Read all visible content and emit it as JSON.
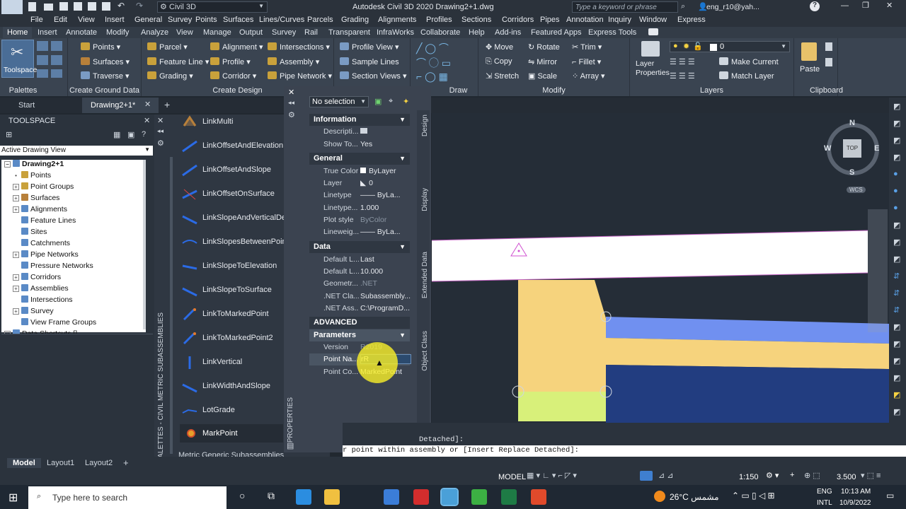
{
  "titlebar": {
    "app_badge": "C3D",
    "workspace": "Civil 3D",
    "title": "Autodesk Civil 3D 2020   Drawing2+1.dwg",
    "search_placeholder": "Type a keyword or phrase",
    "user": "eng_r10@yah..."
  },
  "menubar": [
    "File",
    "Edit",
    "View",
    "Insert",
    "General",
    "Survey",
    "Points",
    "Surfaces",
    "Lines/Curves",
    "Parcels",
    "Grading",
    "Alignments",
    "Profiles",
    "Sections",
    "Corridors",
    "Pipes",
    "Annotation",
    "Inquiry",
    "Window",
    "Express"
  ],
  "ribbon_tabs": [
    "Home",
    "Insert",
    "Annotate",
    "Modify",
    "Analyze",
    "View",
    "Manage",
    "Output",
    "Survey",
    "Rail",
    "Transparent",
    "InfraWorks",
    "Collaborate",
    "Help",
    "Add-ins",
    "Featured Apps",
    "Express Tools"
  ],
  "ribbon": {
    "palettes": {
      "big": "Toolspace",
      "label": "Palettes"
    },
    "ground": {
      "items": [
        "Points",
        "Surfaces",
        "Traverse"
      ],
      "label": "Create Ground Data"
    },
    "design": {
      "items": [
        "Parcel",
        "Feature Line",
        "Grading",
        "Alignment",
        "Profile",
        "Corridor",
        "Intersections",
        "Assembly",
        "Pipe Network"
      ],
      "label": "Create Design"
    },
    "profile": {
      "items": [
        "Profile View",
        "Sample Lines",
        "Section Views"
      ]
    },
    "draw": {
      "label": "Draw"
    },
    "modify": {
      "items": [
        "Move",
        "Copy",
        "Stretch",
        "Rotate",
        "Mirror",
        "Scale",
        "Trim",
        "Fillet",
        "Array"
      ],
      "label": "Modify"
    },
    "layers": {
      "big": "Layer Properties",
      "items": [
        "Make Current",
        "Match Layer"
      ],
      "layer_name": "0",
      "label": "Layers"
    },
    "clipboard": {
      "big": "Paste",
      "label": "Clipboard"
    }
  },
  "doctabs": {
    "start": "Start",
    "drawing": "Drawing2+1*"
  },
  "toolspace": {
    "title": "TOOLSPACE",
    "view": "Active Drawing View",
    "root": "Drawing2+1",
    "items": [
      "Points",
      "Point Groups",
      "Surfaces",
      "Alignments",
      "Feature Lines",
      "Sites",
      "Catchments",
      "Pipe Networks",
      "Pressure Networks",
      "Corridors",
      "Assemblies",
      "Intersections",
      "Survey",
      "View Frame Groups",
      "Data Shortcuts []"
    ]
  },
  "palette": {
    "items": [
      "LinkMulti",
      "LinkOffsetAndElevation",
      "LinkOffsetAndSlope",
      "LinkOffsetOnSurface",
      "LinkSlopeAndVerticalDefl",
      "LinkSlopesBetweenPoints",
      "LinkSlopeToElevation",
      "LinkSlopeToSurface",
      "LinkToMarkedPoint",
      "LinkToMarkedPoint2",
      "LinkVertical",
      "LinkWidthAndSlope",
      "LotGrade",
      "MarkPoint"
    ],
    "footer": "Metric Generic Subassemblies",
    "side_label": "TOOL PALETTES - CIVIL METRIC SUBASSEMBLIES"
  },
  "properties": {
    "selection": "No selection",
    "side_label": "PROPERTIES",
    "vtabs": [
      "Design",
      "Display",
      "Extended Data",
      "Object Class"
    ],
    "information": {
      "title": "Information",
      "rows": [
        [
          "Descripti...",
          ""
        ],
        [
          "Show To...",
          "Yes"
        ]
      ]
    },
    "general": {
      "title": "General",
      "rows": [
        [
          "True Color",
          "ByLayer"
        ],
        [
          "Layer",
          "0"
        ],
        [
          "Linetype",
          "—— ByLa..."
        ],
        [
          "Linetype...",
          "1.000"
        ],
        [
          "Plot style",
          "ByColor"
        ],
        [
          "Lineweig...",
          "—— ByLa..."
        ]
      ]
    },
    "data": {
      "title": "Data",
      "rows": [
        [
          "Default L...",
          "Last"
        ],
        [
          "Default L...",
          "10.000"
        ],
        [
          "Geometr...",
          ".NET"
        ],
        [
          ".NET Cla...",
          "Subassembly..."
        ],
        [
          ".NET Ass...",
          "C:\\ProgramD..."
        ]
      ]
    },
    "advanced": {
      "title": "ADVANCED"
    },
    "parameters": {
      "title": "Parameters",
      "rows": [
        [
          "Version",
          "R2019"
        ],
        [
          "Point Na...",
          "rR"
        ],
        [
          "Point Co...",
          "MarkedPoint"
        ]
      ]
    }
  },
  "viewcube": {
    "n": "N",
    "s": "S",
    "e": "E",
    "w": "W",
    "top": "TOP",
    "wcs": "WCS"
  },
  "command": {
    "line1": "Detached]:",
    "line2": "r point within assembly or [Insert Replace Detached]:"
  },
  "status": {
    "model_tab": "Model",
    "layouts": [
      "Layout1",
      "Layout2"
    ],
    "model": "MODEL",
    "scale": "1:150",
    "value": "3.500"
  },
  "taskbar": {
    "search": "Type here to search",
    "weather": "26°C  مشمس",
    "lang1": "ENG",
    "lang2": "INTL",
    "time": "10:13 AM",
    "date": "10/9/2022"
  }
}
